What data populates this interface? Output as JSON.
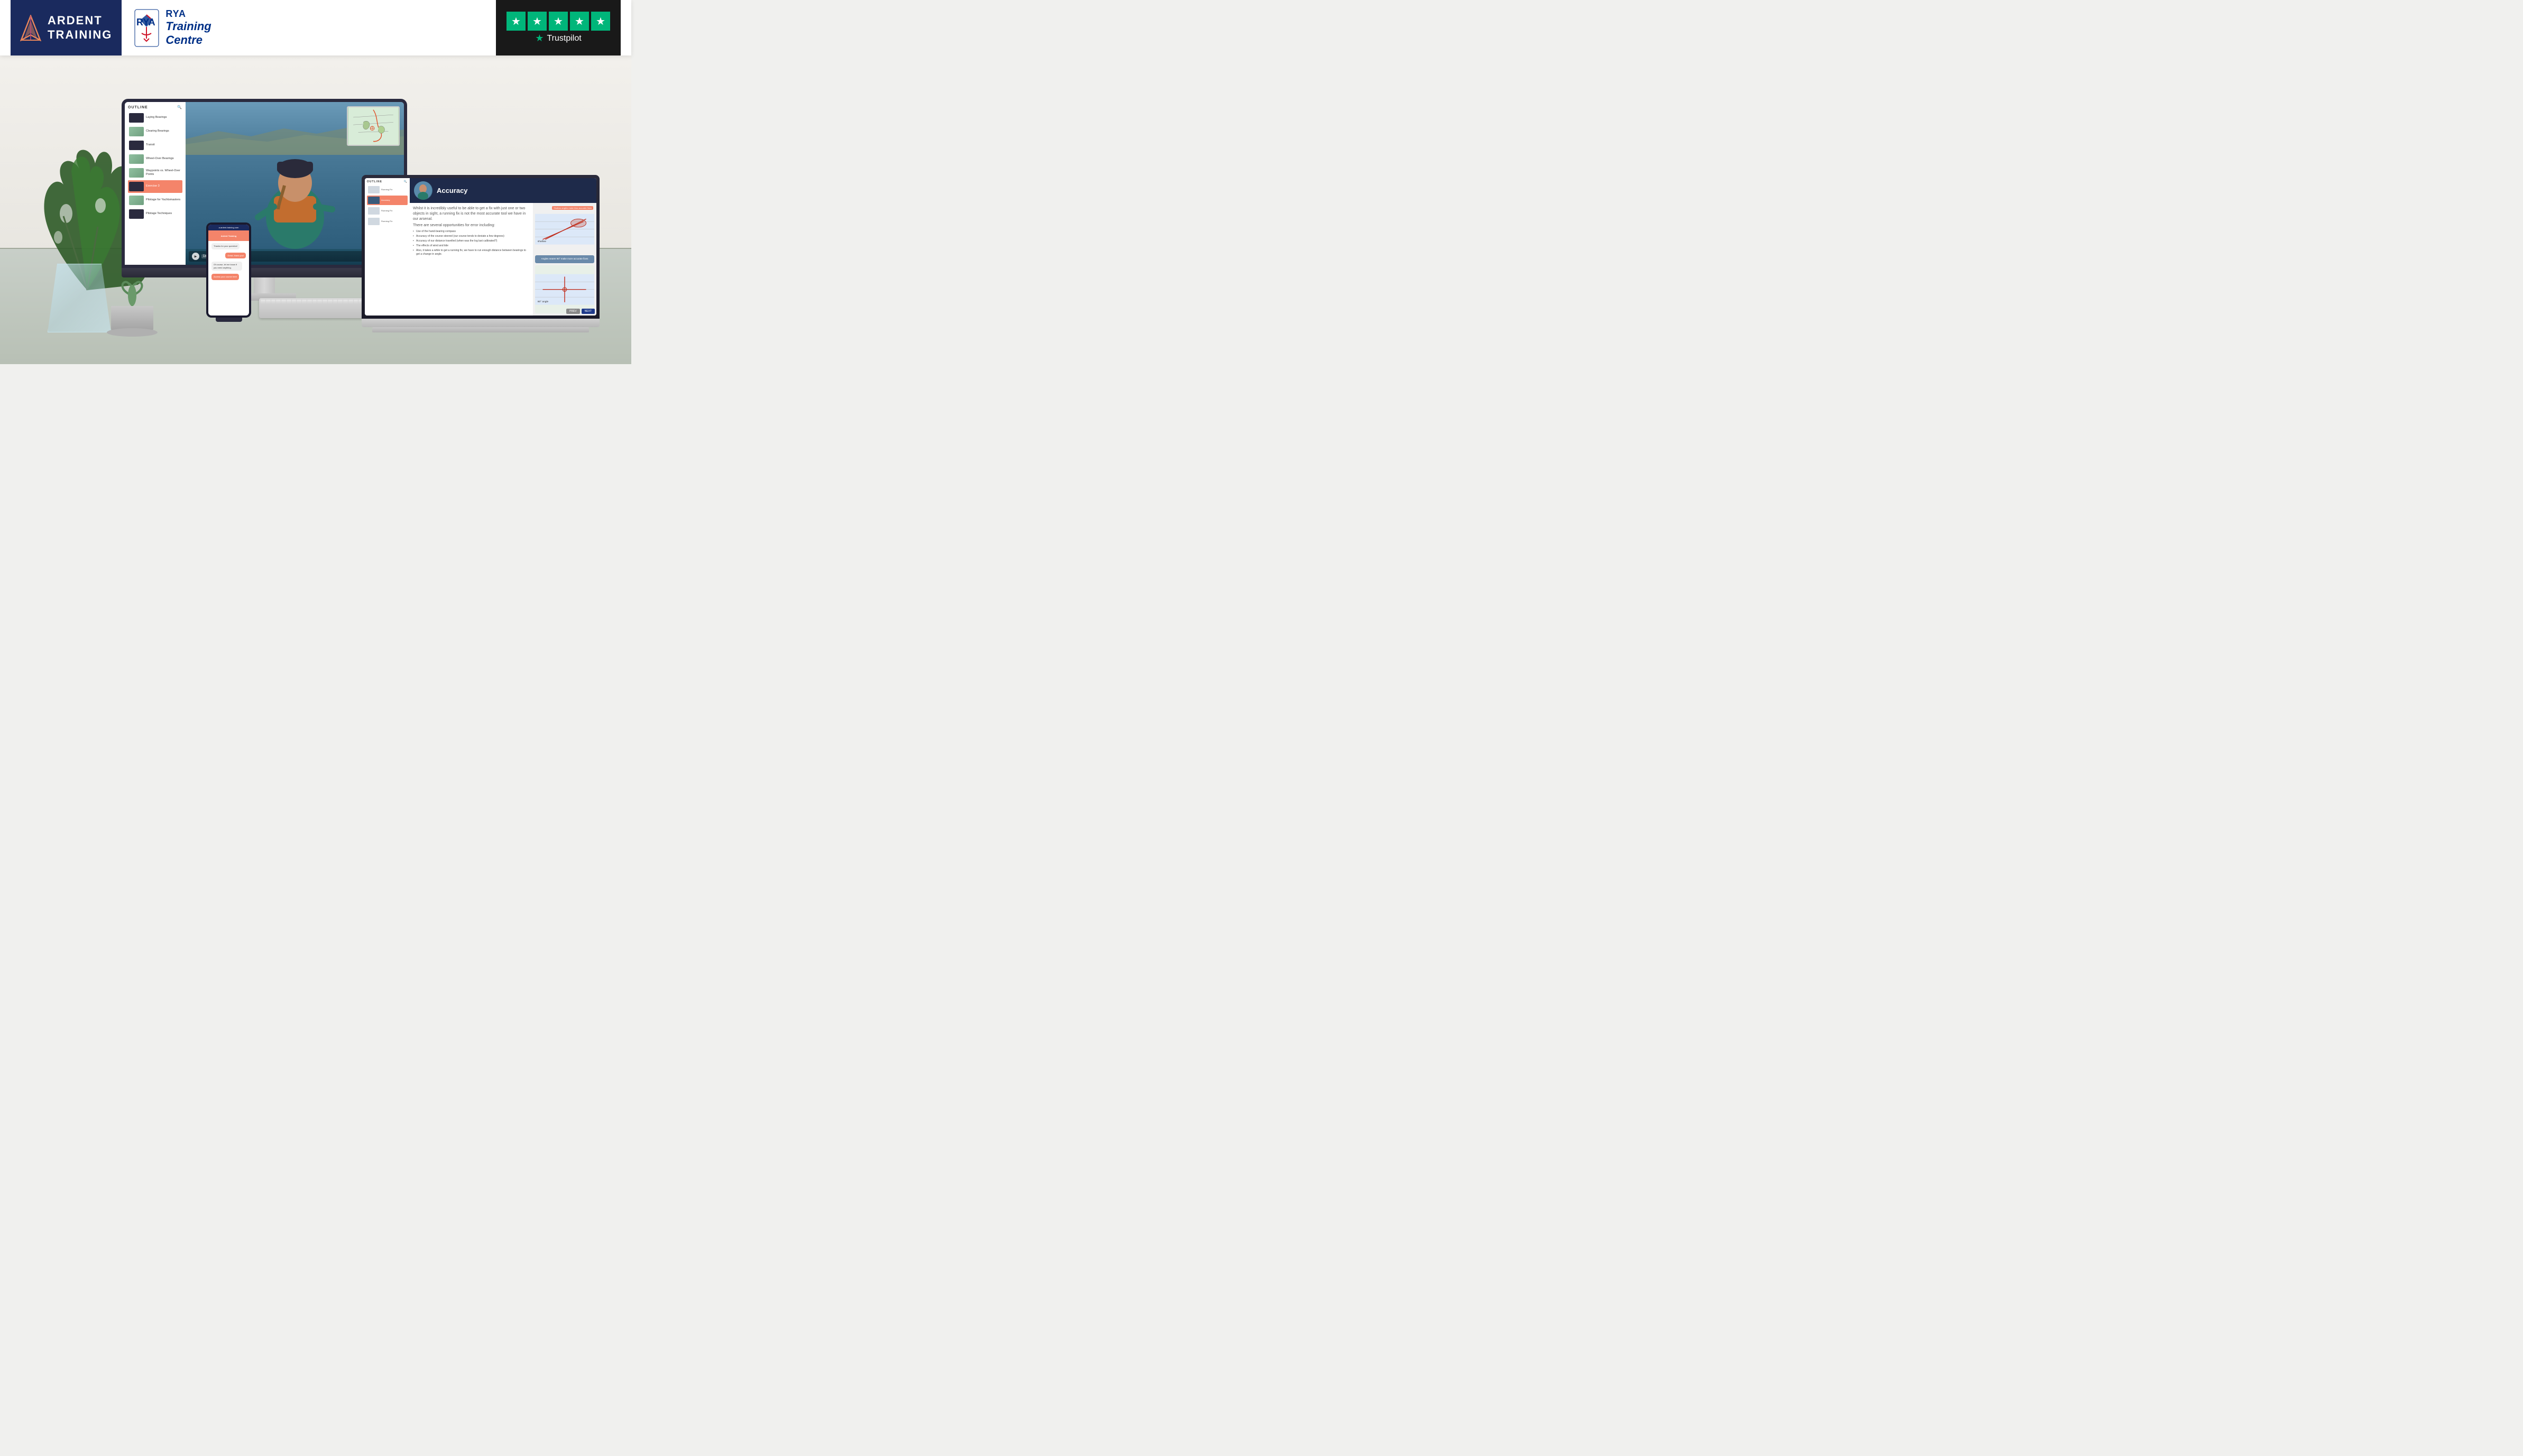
{
  "header": {
    "ardent": {
      "name_line1": "ARDENT",
      "name_line2": "TRAINING"
    },
    "rya": {
      "name": "RYA",
      "sub_line1": "Training",
      "sub_line2": "Centre"
    },
    "trustpilot": {
      "label": "Trustpilot",
      "stars": 5
    }
  },
  "monitor": {
    "sidebar": {
      "title": "OUTLINE",
      "items": [
        {
          "label": "Laying Bearings",
          "type": "dark"
        },
        {
          "label": "Clearing Bearings",
          "type": "map"
        },
        {
          "label": "Transit",
          "type": "dark"
        },
        {
          "label": "Wheel-Over Bearings",
          "type": "map"
        },
        {
          "label": "Waypoint vs Wheel-Over Points",
          "type": "map"
        },
        {
          "label": "Exercise 3",
          "type": "active"
        },
        {
          "label": "Pilotage for Yachtsmasters",
          "type": "map"
        },
        {
          "label": "Pilotage Techniques",
          "type": "dark"
        }
      ]
    },
    "video": {
      "exercise_label": "Exercise 3",
      "speed": "1x"
    }
  },
  "laptop": {
    "sidebar": {
      "title": "OUTLINE",
      "items": [
        {
          "label": "Running Fix"
        },
        {
          "label": "Accuracy"
        },
        {
          "label": "Running Fix"
        },
        {
          "label": "Running Fix"
        }
      ]
    },
    "main": {
      "title": "Accuracy",
      "body_text": "Whilst it is incredibly useful to be able to get a fix with just one or two objects in sight, a running fix is not the most accurate tool we have in our arsenal.",
      "body_sub": "There are several opportunities for error including:",
      "bullets": [
        "Use of the hand-bearing compass",
        "Accuracy of the course steered (our course tends to deviate a few degrees)",
        "Accuracy of our distance travelled (when was the log last calibrated?)",
        "The effects of wind and tide",
        "Also, it takes a while to get a running fix, we have to run enough distance between bearings to get a change in angle."
      ],
      "map_labels": [
        "Shallow angles make less accurate fixes",
        "Angles nearer 90° make more accurate fixes"
      ],
      "nav": {
        "prev": "PREV",
        "next": "NEXT"
      }
    }
  },
  "phone": {
    "header": "a.ardent-training.com",
    "messages": [
      {
        "text": "Thanks for your question!",
        "type": "received"
      },
      {
        "text": "Great, thank you so much!",
        "type": "sent"
      },
      {
        "text": "Of course, let me know if you need anything else.",
        "type": "received"
      },
      {
        "text": "Will do, access your course materials below.",
        "type": "received"
      }
    ],
    "cta": "Access your course here"
  }
}
